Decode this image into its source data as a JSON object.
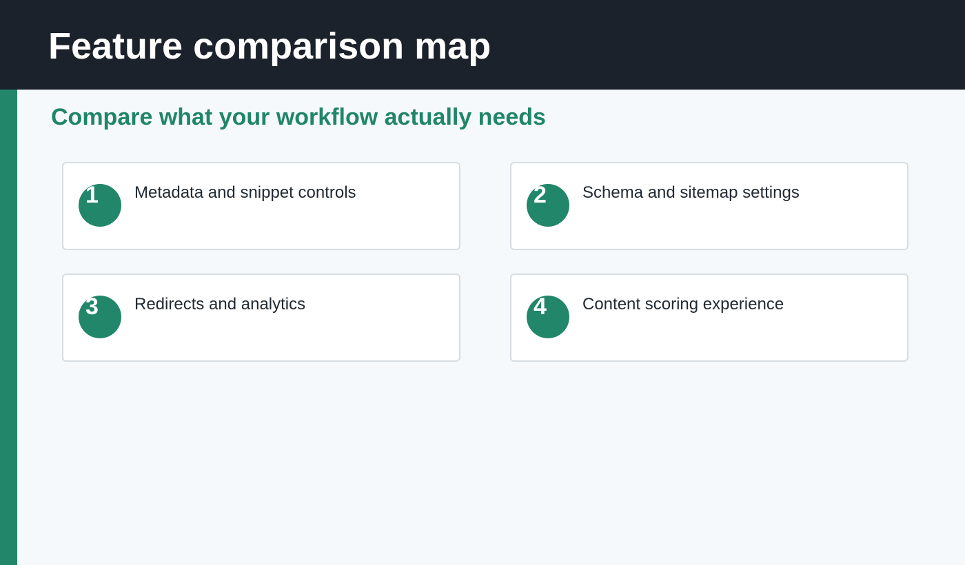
{
  "header": {
    "title": "Feature comparison map"
  },
  "subtitle": "Compare what your workflow actually needs",
  "colors": {
    "header_bg": "#1c222b",
    "accent": "#22866a",
    "page_bg": "#f5f9fc"
  },
  "features": [
    {
      "number": "1",
      "label": "Metadata and snippet controls"
    },
    {
      "number": "2",
      "label": "Schema and sitemap settings"
    },
    {
      "number": "3",
      "label": "Redirects and analytics"
    },
    {
      "number": "4",
      "label": "Content scoring experience"
    }
  ]
}
